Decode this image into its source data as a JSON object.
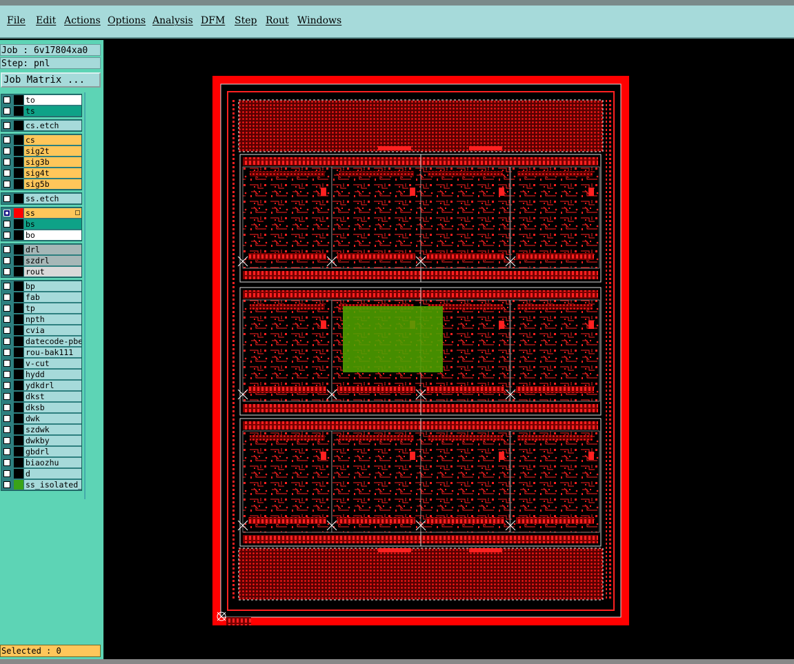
{
  "menu": {
    "items": [
      {
        "label": "File"
      },
      {
        "label": "Edit"
      },
      {
        "label": "Actions"
      },
      {
        "label": "Options"
      },
      {
        "label": "Analysis"
      },
      {
        "label": "DFM"
      },
      {
        "label": "Step"
      },
      {
        "label": "Rout"
      },
      {
        "label": "Windows"
      }
    ]
  },
  "sidebar": {
    "job_line": "Job : 6v17804xa0",
    "step_line": "Step: pnl",
    "job_matrix_label": "Job Matrix ...",
    "selected_line": "Selected : 0"
  },
  "layer_groups": [
    {
      "layers": [
        {
          "name": "to",
          "color": "white",
          "checked": false
        },
        {
          "name": "ts",
          "color": "teal",
          "checked": false
        }
      ]
    },
    {
      "layers": [
        {
          "name": "cs.etch",
          "color": "cyan",
          "checked": false
        }
      ]
    },
    {
      "layers": [
        {
          "name": "cs",
          "color": "orange",
          "checked": false
        },
        {
          "name": "sig2t",
          "color": "orange",
          "checked": false
        },
        {
          "name": "sig3b",
          "color": "orange",
          "checked": false
        },
        {
          "name": "sig4t",
          "color": "orange",
          "checked": false
        },
        {
          "name": "sig5b",
          "color": "orange",
          "checked": false
        }
      ]
    },
    {
      "layers": [
        {
          "name": "ss.etch",
          "color": "cyan",
          "checked": false
        }
      ]
    },
    {
      "layers": [
        {
          "name": "ss",
          "color": "orange",
          "checked": true,
          "swatch": "#ff0000",
          "marked": true
        },
        {
          "name": "bs",
          "color": "teal",
          "checked": false
        },
        {
          "name": "bo",
          "color": "white",
          "checked": false
        }
      ]
    },
    {
      "layers": [
        {
          "name": "drl",
          "color": "gray",
          "checked": false
        },
        {
          "name": "szdrl",
          "color": "gray",
          "checked": false
        },
        {
          "name": "rout",
          "color": "lgray",
          "checked": false
        }
      ]
    },
    {
      "layers": [
        {
          "name": "bp",
          "color": "cyan",
          "checked": false
        },
        {
          "name": "fab",
          "color": "cyan",
          "checked": false
        },
        {
          "name": "tp",
          "color": "cyan",
          "checked": false
        },
        {
          "name": "npth",
          "color": "cyan",
          "checked": false
        },
        {
          "name": "cvia",
          "color": "cyan",
          "checked": false
        },
        {
          "name": "datecode-pbe",
          "color": "cyan",
          "checked": false
        },
        {
          "name": "rou-bak111",
          "color": "cyan",
          "checked": false
        },
        {
          "name": "v-cut",
          "color": "cyan",
          "checked": false
        },
        {
          "name": "hydd",
          "color": "cyan",
          "checked": false
        },
        {
          "name": "ydkdrl",
          "color": "cyan",
          "checked": false
        },
        {
          "name": "dkst",
          "color": "cyan",
          "checked": false
        },
        {
          "name": "dksb",
          "color": "cyan",
          "checked": false
        },
        {
          "name": "dwk",
          "color": "cyan",
          "checked": false
        },
        {
          "name": "szdwk",
          "color": "cyan",
          "checked": false
        },
        {
          "name": "dwkby",
          "color": "cyan",
          "checked": false
        },
        {
          "name": "gbdrl",
          "color": "cyan",
          "checked": false
        },
        {
          "name": "biaozhu",
          "color": "cyan",
          "checked": false
        },
        {
          "name": "d",
          "color": "cyan",
          "checked": false
        },
        {
          "name": "ss_isolated_",
          "color": "cyan",
          "checked": false,
          "swatch": "#3aa317"
        }
      ]
    }
  ],
  "colors": {
    "panel_red": "#ff0000",
    "copper_dark": "#6a0000",
    "highlight_green": "#4ea000",
    "menubar_bg": "#a6dada",
    "sidebar_bg": "#5dd4b5"
  }
}
